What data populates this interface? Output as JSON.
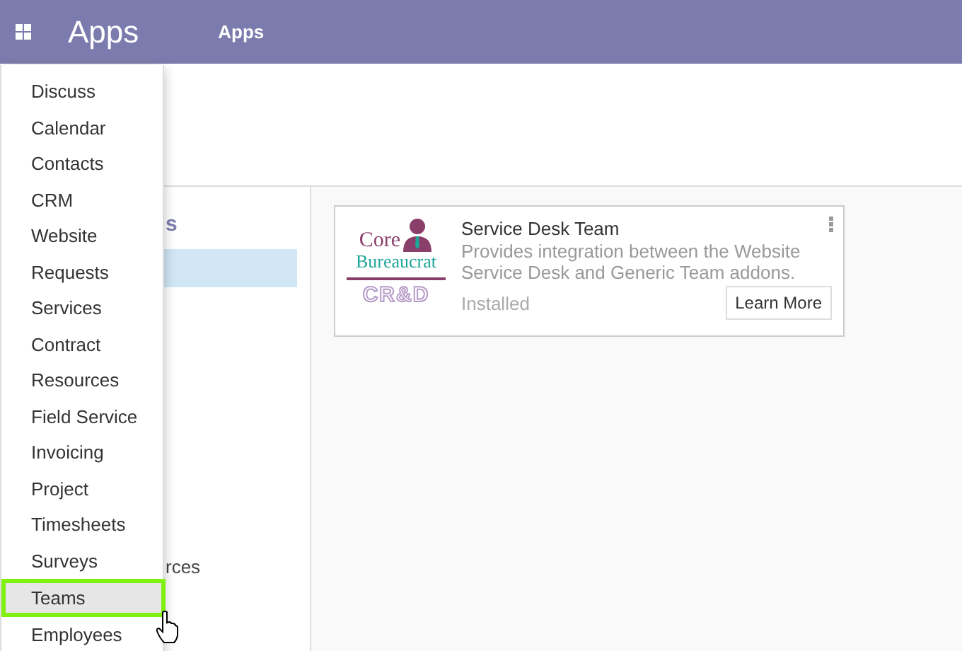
{
  "navbar": {
    "brand": "Apps",
    "menu": "Apps"
  },
  "sidebar": {
    "heading": "s",
    "items": [
      {
        "selected": true
      },
      {
        "label": "rces",
        "selected": false
      }
    ]
  },
  "app_card": {
    "logo": {
      "top": "Core",
      "middle": "Bureaucrat",
      "bottom": "CR&D"
    },
    "title": "Service Desk Team",
    "description": "Provides integration between the Website Service Desk and Generic Team addons.",
    "status": "Installed",
    "button": "Learn More"
  },
  "apps_menu": {
    "items": [
      {
        "label": "Discuss",
        "selected": false
      },
      {
        "label": "Calendar",
        "selected": false
      },
      {
        "label": "Contacts",
        "selected": false
      },
      {
        "label": "CRM",
        "selected": false
      },
      {
        "label": "Website",
        "selected": false
      },
      {
        "label": "Requests",
        "selected": false
      },
      {
        "label": "Services",
        "selected": false
      },
      {
        "label": "Contract",
        "selected": false
      },
      {
        "label": "Resources",
        "selected": false
      },
      {
        "label": "Field Service",
        "selected": false
      },
      {
        "label": "Invoicing",
        "selected": false
      },
      {
        "label": "Project",
        "selected": false
      },
      {
        "label": "Timesheets",
        "selected": false
      },
      {
        "label": "Surveys",
        "selected": false
      },
      {
        "label": "Teams",
        "selected": true
      },
      {
        "label": "Employees",
        "selected": false
      }
    ]
  }
}
